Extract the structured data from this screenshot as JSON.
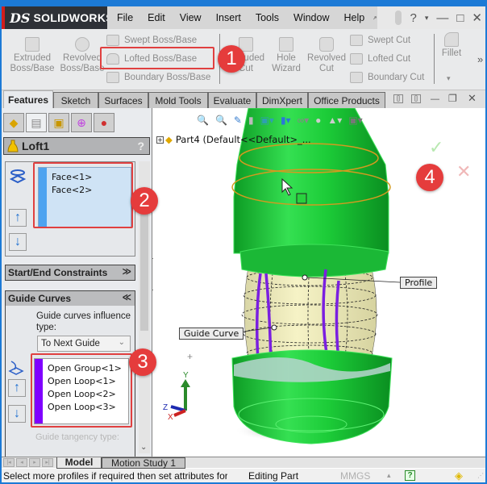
{
  "app": {
    "brand": "SOLIDWORKS",
    "brand_mark": "DS"
  },
  "menu": {
    "items": [
      "File",
      "Edit",
      "View",
      "Insert",
      "Tools",
      "Window",
      "Help"
    ],
    "icons": {
      "pin": "pushpin-icon",
      "help": "?",
      "minimize": "—",
      "restore": "□",
      "close": "✕"
    }
  },
  "command_manager": {
    "large_buttons": [
      {
        "label_line1": "Extruded",
        "label_line2": "Boss/Base",
        "icon": "extruded-boss-icon"
      },
      {
        "label_line1": "Revolved",
        "label_line2": "Boss/Base",
        "icon": "revolved-boss-icon"
      },
      {
        "label_line1": "Extruded",
        "label_line2": "Cut",
        "icon": "extruded-cut-icon"
      },
      {
        "label_line1": "Hole",
        "label_line2": "Wizard",
        "icon": "hole-wizard-icon"
      },
      {
        "label_line1": "Revolved",
        "label_line2": "Cut",
        "icon": "revolved-cut-icon"
      },
      {
        "label_line1": "Fillet",
        "label_line2": "",
        "icon": "fillet-icon"
      }
    ],
    "boss_stack": [
      "Swept Boss/Base",
      "Lofted Boss/Base",
      "Boundary Boss/Base"
    ],
    "cut_stack": [
      "Swept Cut",
      "Lofted Cut",
      "Boundary Cut"
    ],
    "more": "»",
    "fillet_dropdown": "▾"
  },
  "tabs": {
    "items": [
      "Features",
      "Sketch",
      "Surfaces",
      "Mold Tools",
      "Evaluate",
      "DimXpert",
      "Office Products"
    ],
    "active": "Features"
  },
  "property_manager": {
    "title": "Loft1",
    "help": "?",
    "ok": "✔",
    "cancel": "✖",
    "profiles": {
      "items": [
        "Face<1>",
        "Face<2>"
      ],
      "stripe_color": "#4da3f0"
    },
    "start_end": {
      "title": "Start/End Constraints",
      "chevron": "≫"
    },
    "guide_curves": {
      "title": "Guide Curves",
      "chevron": "≪",
      "influence_label": "Guide curves influence type:",
      "influence_value": "To Next Guide",
      "items": [
        "Open Group<1>",
        "Open Loop<1>",
        "Open Loop<2>",
        "Open Loop<3>"
      ],
      "stripe_color": "#8000ff",
      "tangency_label": "Guide tangency type:"
    },
    "arrows": {
      "up": "↑",
      "down": "↓"
    }
  },
  "graphics": {
    "tree_item": "Part4  (Default<<Default>_...",
    "callouts": {
      "profile": "Profile",
      "guide_curve": "Guide Curve"
    },
    "triad": {
      "x": "X",
      "y": "Y",
      "z": "Z"
    },
    "confirm": {
      "ok": "✓",
      "cancel": "✕"
    }
  },
  "annotations": [
    "1",
    "2",
    "3",
    "4"
  ],
  "bottom_tabs": {
    "items": [
      "Model",
      "Motion Study 1"
    ],
    "active": "Model"
  },
  "status": {
    "message": "Select more profiles if required then set attributes for",
    "mode": "Editing Part",
    "units": "MMGS",
    "units_caret": "▴",
    "help": "?"
  },
  "colors": {
    "accent_red": "#e53c3c",
    "bottle_green": "#1fc43a",
    "guide_purple": "#7a1fe0"
  }
}
